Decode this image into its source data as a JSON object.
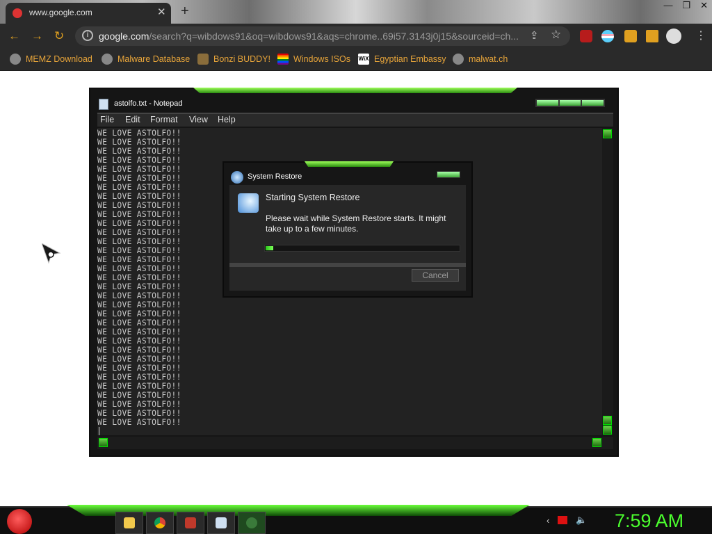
{
  "browser": {
    "tab_title": "www.google.com",
    "tab_close": "✕",
    "new_tab": "+",
    "window_controls": [
      "—",
      "❐",
      "✕"
    ],
    "nav": {
      "back": "←",
      "forward": "→",
      "reload": "↻"
    },
    "url_host": "google.com",
    "url_rest": "/search?q=wibdows91&oq=wibdows91&aqs=chrome..69i57.3143j0j15&sourceid=ch...",
    "share_icon": "⇪",
    "star_icon": "☆"
  },
  "bookmarks": [
    {
      "label": "MEMZ Download",
      "color": "#888888"
    },
    {
      "label": "Malware Database",
      "color": "#888888"
    },
    {
      "label": "Bonzi BUDDY!",
      "color": "#8a6d3b"
    },
    {
      "label": "Windows ISOs",
      "color": "#d94d3b"
    },
    {
      "label": "Egyptian Embassy",
      "color": "#ffffff"
    },
    {
      "label": "malwat.ch",
      "color": "#888888"
    }
  ],
  "notepad": {
    "title": "astolfo.txt - Notepad",
    "menu": [
      "File",
      "Edit",
      "Format",
      "View",
      "Help"
    ],
    "line_text": "WE LOVE ASTOLFO!!",
    "line_count": 33
  },
  "restore": {
    "title": "System Restore",
    "heading": "Starting System Restore",
    "message": "Please wait while System Restore starts. It might take up to a few minutes.",
    "progress": 0.04,
    "cancel_label": "Cancel"
  },
  "taskbar": {
    "clock": "7:59 AM"
  },
  "colors": {
    "accent_green": "#4bff2e",
    "bookmark_text": "#e8a53a"
  }
}
